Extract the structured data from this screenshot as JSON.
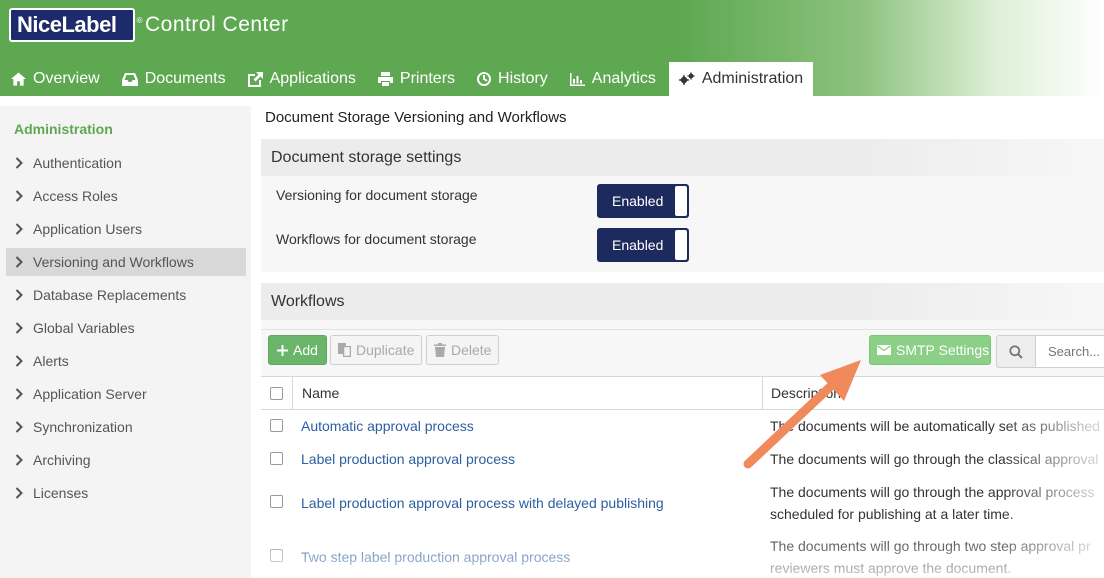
{
  "brand": {
    "logo_text": "NiceLabel",
    "trademark": "®",
    "app_title": "Control Center",
    "accent": "#5fa852",
    "navy": "#1d2a5e"
  },
  "tabs": [
    {
      "label": "Overview",
      "icon": "home-icon"
    },
    {
      "label": "Documents",
      "icon": "inbox-icon"
    },
    {
      "label": "Applications",
      "icon": "external-edit-icon"
    },
    {
      "label": "Printers",
      "icon": "printer-icon"
    },
    {
      "label": "History",
      "icon": "clock-icon"
    },
    {
      "label": "Analytics",
      "icon": "bar-chart-icon"
    },
    {
      "label": "Administration",
      "icon": "gears-icon",
      "active": true
    }
  ],
  "sidebar": {
    "title": "Administration",
    "items": [
      {
        "label": "Authentication"
      },
      {
        "label": "Access Roles"
      },
      {
        "label": "Application Users"
      },
      {
        "label": "Versioning and Workflows",
        "active": true
      },
      {
        "label": "Database Replacements"
      },
      {
        "label": "Global Variables"
      },
      {
        "label": "Alerts"
      },
      {
        "label": "Application Server"
      },
      {
        "label": "Synchronization"
      },
      {
        "label": "Archiving"
      },
      {
        "label": "Licenses"
      }
    ]
  },
  "main": {
    "page_title": "Document Storage Versioning and Workflows",
    "storage_panel": {
      "heading": "Document storage settings",
      "settings": [
        {
          "label": "Versioning for document storage",
          "state": "Enabled"
        },
        {
          "label": "Workflows for document storage",
          "state": "Enabled"
        }
      ]
    },
    "workflows_panel": {
      "heading": "Workflows",
      "toolbar": {
        "add_label": "Add",
        "duplicate_label": "Duplicate",
        "delete_label": "Delete",
        "smtp_label": "SMTP Settings",
        "search_placeholder": "Search..."
      },
      "columns": [
        "Name",
        "Description"
      ],
      "rows": [
        {
          "name": "Automatic approval process",
          "description": [
            "The documents will be automatically set as published"
          ]
        },
        {
          "name": "Label production approval process",
          "description": [
            "The documents will go through the classical approval"
          ]
        },
        {
          "name": "Label production approval process with delayed publishing",
          "description": [
            "The documents will go through the approval process",
            "scheduled for publishing at a later time."
          ]
        },
        {
          "name": "Two step label production approval process",
          "description": [
            "The documents will go through two step approval pr",
            "reviewers must approve the document."
          ]
        }
      ]
    },
    "annotation": {
      "arrow_color": "#f08a5d",
      "points_to": "smtp-settings-button"
    }
  }
}
